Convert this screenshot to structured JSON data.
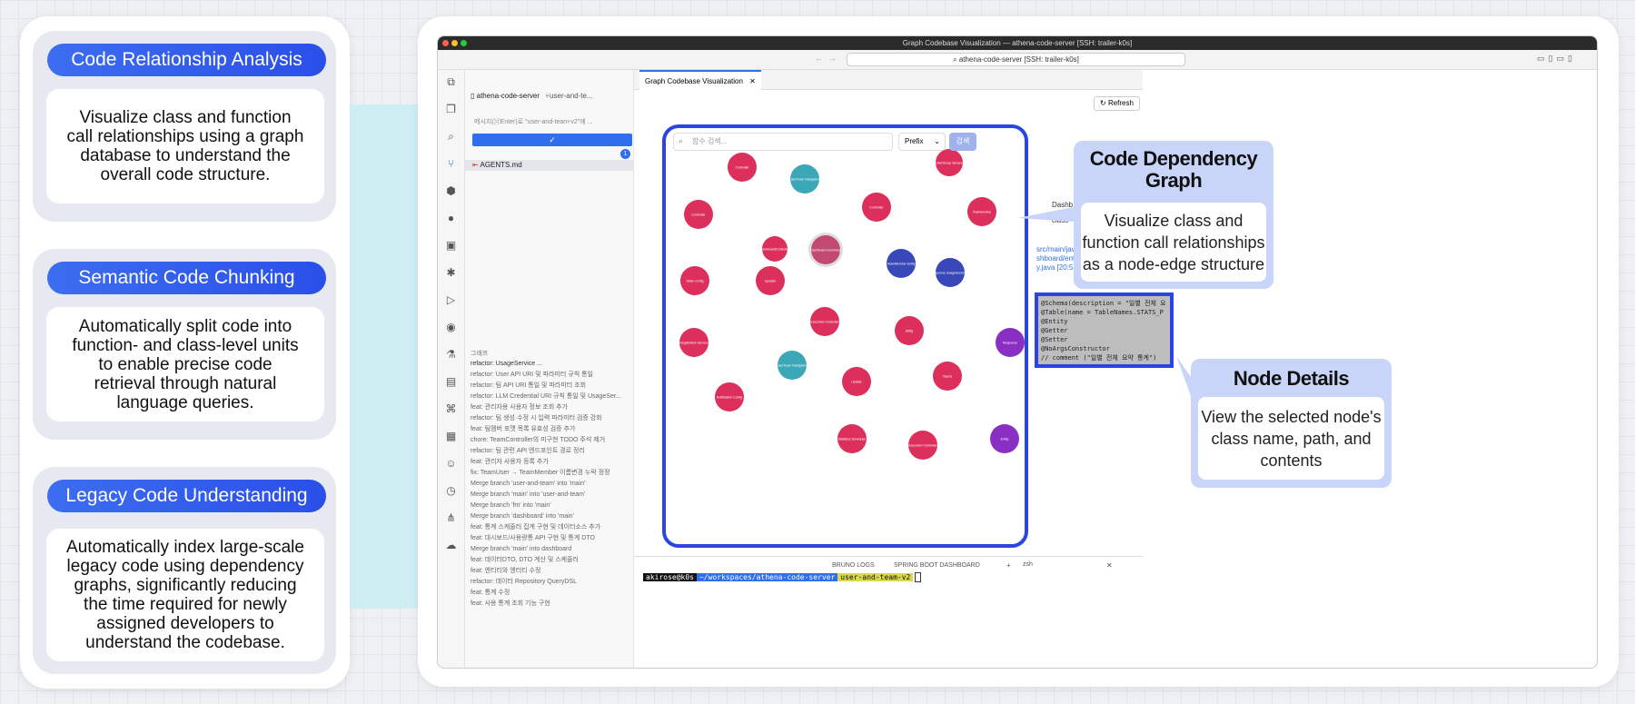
{
  "features": [
    {
      "title": "Code Relationship Analysis",
      "body": "Visualize class and function call relationships using a graph database to understand the overall code structure."
    },
    {
      "title": "Semantic Code Chunking",
      "body": "Automatically split code into function- and class-level units to enable precise code retrieval through natural language queries."
    },
    {
      "title": "Legacy Code Understanding",
      "body": "Automatically index large-scale legacy code using dependency graphs, significantly reducing the time required for newly assigned developers to understand the codebase."
    }
  ],
  "window": {
    "title": "Graph Codebase Visualization — athena-code-server [SSH: trailer-k0s]",
    "command_search": "athena-code-server [SSH: trailer-k0s]"
  },
  "sidebar": {
    "repo": "athena-code-server",
    "branch": "user-and-te...",
    "commit_placeholder": "메시지(⌘Enter)로 \"user-and-team-v2\"에 ...",
    "badge": "1",
    "changed_file": "AGENTS.md",
    "graph_label": "그래프",
    "commits": [
      "refactor: UsageService ...",
      "refactor: User API URI 및 파라미터 규칙 통일",
      "refactor: 팀 API URI 통일 및 파라미터 조회",
      "refactor: LLM Credential URI 규칙 통일 및 UsageSer...",
      "feat: 관리자용 사용자 정보 조회 추가",
      "refactor: 팀 생성·수정 시 입력 파라미터 검증 강화",
      "feat: 팀멤버 포맷 목록 유효성 검증 추가",
      "chore: TeamController의 미구현 TODO 주석 제거",
      "refactor: 팀 관련 API 엔드포인트 경로 정리",
      "feat: 관리자 사용자 등록 추가",
      "fix: TeamUser → TeamMember 이름변경 누락 정정",
      "Merge branch 'user-and-team' into 'main'",
      "Merge branch 'main' into 'user-and-team'",
      "Merge branch 'fm' into 'main'",
      "Merge branch 'dashboard' into 'main'",
      "feat: 통계 스케줄러 집계 구현 및 데이터소스 추가",
      "feat: 대시보드/사용량통 API 구현 및 통계 DTO",
      "Merge branch 'main' into dashboard",
      "feat: 데이터DTO, DTO 계산 및 스케줄러",
      "feat: 엔티티와 엔터티 수정",
      "refactor: 데이터 Repository QueryDSL",
      "feat: 통계 수정",
      "feat: 사용 통계 조회 기능 구현"
    ]
  },
  "editor": {
    "tab": "Graph Codebase Visualization",
    "refresh": "Refresh",
    "search_placeholder": "함수 검색...",
    "prefix": "Prefix",
    "search_button": "검색",
    "side_tabs": [
      "Dashb",
      "class"
    ],
    "path_lines": [
      "src/main/jav",
      "shboard/ent",
      "y.java [20:5"
    ],
    "code": "@Schema(description = \"일별 전체 요\n@Table(name = TableNames.STATS_P\n@Entity\n@Getter\n@Setter\n@NoArgsConstructor\n// comment (\"일별 전체 요약 통계\")"
  },
  "terminal": {
    "tabs": [
      "BRUNO LOGS",
      "SPRING BOOT DASHBOARD"
    ],
    "shell": "zsh",
    "user": "akirose@k0s",
    "path": "~/workspaces/athena-code-server",
    "branch": "user-and-team-v2"
  },
  "callouts": [
    {
      "title": "Code Dependency Graph",
      "body": "Visualize class and function call relationships as a node-edge structure"
    },
    {
      "title": "Node Details",
      "body": "View the selected node's class name, path, and contents"
    }
  ],
  "colors": {
    "pill": "#2f5cec",
    "graph_border": "#2b46e0",
    "node_red": "#dc2f5c",
    "node_teal": "#3ba7b7",
    "node_blue": "#3848b8",
    "node_purple": "#8a2fc4"
  },
  "graph_nodes": [
    {
      "color": "node_red",
      "label": "Controller"
    },
    {
      "color": "node_teal",
      "label": "UserTeam Navigation"
    },
    {
      "color": "node_red",
      "label": "UserGroup Service"
    },
    {
      "color": "node_red",
      "label": "Controller"
    },
    {
      "color": "node_red",
      "label": "Controller"
    },
    {
      "color": "node_red",
      "label": "TeamService"
    },
    {
      "color": "node_red",
      "label": "DashboardController"
    },
    {
      "color": "node_gray",
      "label": "Dashboard Summary"
    },
    {
      "color": "node_blue",
      "label": "TeamMember Entity"
    },
    {
      "color": "node_blue",
      "label": "Response UsageSummary"
    },
    {
      "color": "node_red",
      "label": "Stats Config"
    },
    {
      "color": "node_red",
      "label": "Updater"
    },
    {
      "color": "node_red",
      "label": "Execution Controller"
    },
    {
      "color": "node_red",
      "label": "Utility"
    },
    {
      "color": "node_red",
      "label": "Registration Service"
    },
    {
      "color": "node_purple",
      "label": "Response"
    },
    {
      "color": "node_teal",
      "label": "UserTeam Navigation"
    },
    {
      "color": "node_red",
      "label": "Update"
    },
    {
      "color": "node_red",
      "label": "Teams"
    },
    {
      "color": "node_red",
      "label": "Notification Config"
    },
    {
      "color": "node_red",
      "label": "Statistics Scheduler"
    },
    {
      "color": "node_red",
      "label": "Execution Controller"
    },
    {
      "color": "node_purple",
      "label": "Entity"
    }
  ]
}
